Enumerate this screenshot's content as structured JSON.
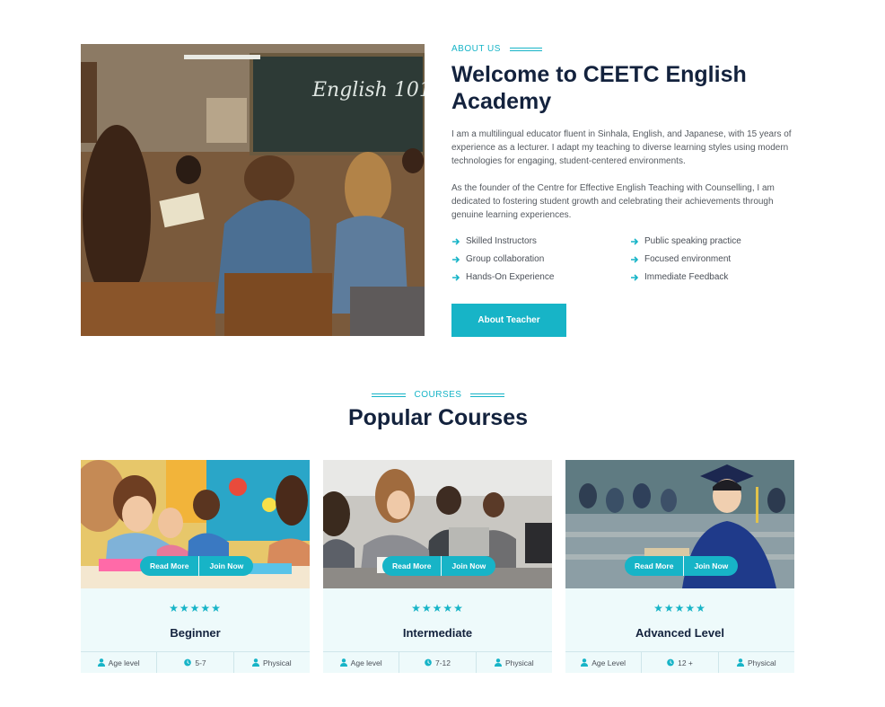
{
  "about": {
    "eyebrow": "ABOUT US",
    "title": "Welcome to CEETC English Academy",
    "board_text": "English 101",
    "paragraphs": [
      "I am a multilingual educator fluent in Sinhala, English, and Japanese, with 15 years of experience as a lecturer. I adapt my teaching to diverse learning styles using modern technologies for engaging, student-centered environments.",
      "As the founder of the Centre for Effective English Teaching with Counselling, I am dedicated to fostering student growth and celebrating their achievements through genuine learning experiences."
    ],
    "features": [
      "Skilled Instructors",
      "Public speaking practice",
      "Group collaboration",
      "Focused environment",
      "Hands-On Experience",
      "Immediate Feedback"
    ],
    "button_label": "About Teacher"
  },
  "courses": {
    "eyebrow": "COURSES",
    "title": "Popular Courses",
    "read_more_label": "Read More",
    "join_now_label": "Join Now",
    "items": [
      {
        "title": "Beginner",
        "stars": "★★★★★",
        "age_label": "Age level",
        "age_value": "5-7",
        "mode": "Physical"
      },
      {
        "title": "Intermediate",
        "stars": "★★★★★",
        "age_label": "Age level",
        "age_value": "7-12",
        "mode": "Physical"
      },
      {
        "title": "Advanced Level",
        "stars": "★★★★★",
        "age_label": "Age Level",
        "age_value": "12 +",
        "mode": "Physical"
      }
    ]
  },
  "colors": {
    "accent": "#17b4c7",
    "heading": "#13223d",
    "card_bg": "#eefafb"
  },
  "icons": [
    "arrow-right-icon",
    "user-icon",
    "clock-icon"
  ]
}
